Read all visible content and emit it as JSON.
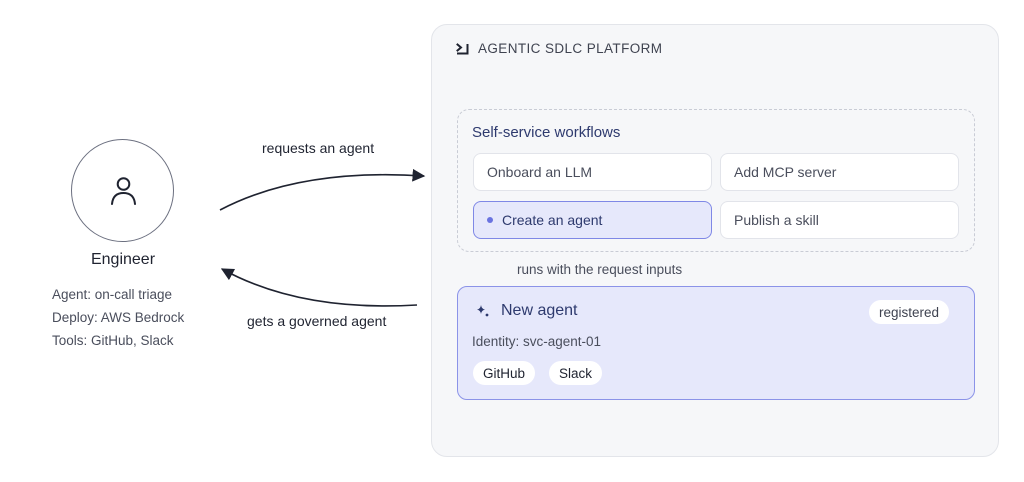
{
  "engineer": {
    "name": "Engineer",
    "attributes": [
      "Agent: on-call triage",
      "Deploy: AWS Bedrock",
      "Tools: GitHub, Slack"
    ]
  },
  "arrows": {
    "request_label": "requests an agent",
    "response_label": "gets a governed agent"
  },
  "platform": {
    "title": "AGENTIC SDLC PLATFORM",
    "workflows": {
      "title": "Self-service workflows",
      "items": [
        {
          "label": "Onboard an LLM",
          "active": false
        },
        {
          "label": "Add MCP server",
          "active": false
        },
        {
          "label": "Create an agent",
          "active": true
        },
        {
          "label": "Publish a skill",
          "active": false
        }
      ]
    },
    "runs_label": "runs with the request inputs",
    "agent": {
      "title": "New agent",
      "status": "registered",
      "identity": "Identity: svc-agent-01",
      "tools": [
        "GitHub",
        "Slack"
      ]
    }
  },
  "colors": {
    "accent": "#6a73e0",
    "card_bg": "#e6e8fb",
    "card_border": "#8b93e8",
    "platform_bg": "#f6f7f9"
  }
}
